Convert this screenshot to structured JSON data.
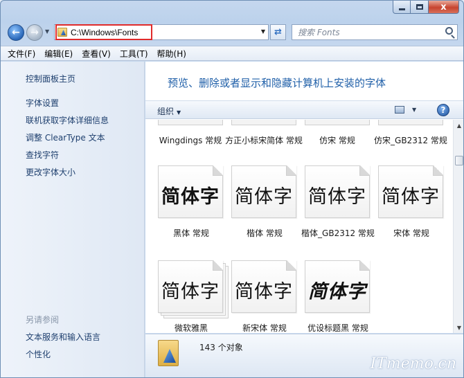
{
  "window": {
    "address_path": "C:\\Windows\\Fonts",
    "search_placeholder": "搜索 Fonts",
    "caption": {
      "minimize": "–",
      "maximize": "□",
      "close": "x"
    }
  },
  "menu": [
    "文件(F)",
    "编辑(E)",
    "查看(V)",
    "工具(T)",
    "帮助(H)"
  ],
  "sidebar": {
    "home": "控制面板主页",
    "links": [
      "字体设置",
      "联机获取字体详细信息",
      "调整 ClearType 文本",
      "查找字符",
      "更改字体大小"
    ],
    "see_also_title": "另请参阅",
    "see_also": [
      "文本服务和输入语言",
      "个性化"
    ]
  },
  "main": {
    "title": "预览、删除或者显示和隐藏计算机上安装的字体",
    "organize": "组织"
  },
  "fonts_previous_row": [
    "Wingdings 常规",
    "方正小标宋简体 常规",
    "仿宋 常规",
    "仿宋_GB2312 常规"
  ],
  "fonts": [
    {
      "preview": "简体字",
      "label": "黑体 常规"
    },
    {
      "preview": "简体字",
      "label": "楷体 常规"
    },
    {
      "preview": "简体字",
      "label": "楷体_GB2312 常规"
    },
    {
      "preview": "简体字",
      "label": "宋体 常规"
    },
    {
      "preview": "简体字",
      "label": "微软雅黑"
    },
    {
      "preview": "简体字",
      "label": "新宋体 常规"
    },
    {
      "preview": "简体字",
      "label": "优设标题黑 常规"
    }
  ],
  "status": {
    "count_text": "143 个对象",
    "watermark": "ITmemo.cn"
  },
  "colors": {
    "title_blue": "#1f5fa8",
    "highlight_red": "#e02a2a",
    "close_red": "#c7442f"
  }
}
